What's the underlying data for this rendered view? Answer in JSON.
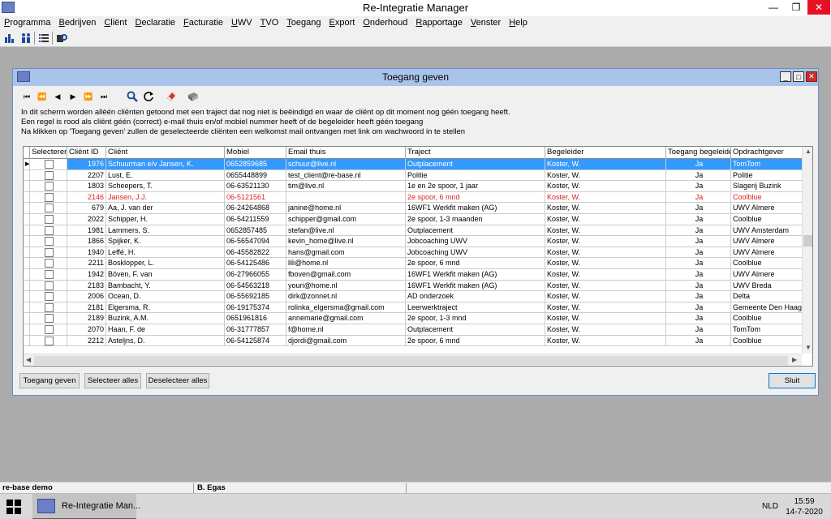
{
  "app": {
    "title": "Re-Integratie Manager",
    "min_icon": "—",
    "restore_icon": "❐",
    "close_icon": "✕"
  },
  "menu": [
    "Programma",
    "Bedrijven",
    "Cliënt",
    "Declaratie",
    "Facturatie",
    "UWV",
    "TVO",
    "Toegang",
    "Export",
    "Onderhoud",
    "Rapportage",
    "Venster",
    "Help"
  ],
  "toolbar_icons": [
    "bar-chart-icon",
    "people-icon",
    "list-icon",
    "key-icon"
  ],
  "dialog": {
    "title": "Toegang geven",
    "nav": [
      "⏮",
      "⏪",
      "◀",
      "▶",
      "⏩",
      "⏭"
    ],
    "info_lines": [
      "In dit scherm worden alléén cliënten getoond met een traject dat nog niet is beëindigd en waar de cliënt op dit moment nog géén toegang heeft.",
      "Een regel is rood als cliënt géén (correct) e-mail thuis en/of mobiel nummer heeft of de begeleider heeft géén toegang",
      "Na klikken op 'Toegang geven' zullen de geselecteerde cliënten een welkomst mail ontvangen met link om wachwoord in te stellen"
    ],
    "columns": [
      "Selecteren",
      "Cliënt ID",
      "Cliënt",
      "Mobiel",
      "Email thuis",
      "Traject",
      "Begeleider",
      "Toegang begeleider",
      "Opdrachtgever"
    ],
    "rows": [
      {
        "id": "1976",
        "client": "Schuurman e/v Jansen, K.",
        "mobiel": "0652859685",
        "email": "schuur@live.nl",
        "traject": "Outplacement",
        "begeleider": "Koster, W.",
        "toegang": "Ja",
        "opdrachtgever": "TomTom",
        "selected": true,
        "red": false
      },
      {
        "id": "2207",
        "client": "Lust, E.",
        "mobiel": "0655448899",
        "email": "test_client@re-base.nl",
        "traject": "Politie",
        "begeleider": "Koster, W.",
        "toegang": "Ja",
        "opdrachtgever": "Politie",
        "selected": false,
        "red": false
      },
      {
        "id": "1803",
        "client": "Scheepers, T.",
        "mobiel": "06-63521130",
        "email": "tim@live.nl",
        "traject": "1e en 2e spoor, 1 jaar",
        "begeleider": "Koster, W.",
        "toegang": "Ja",
        "opdrachtgever": "Slagerij Buzink",
        "selected": false,
        "red": false
      },
      {
        "id": "2146",
        "client": "Jansen, J.J.",
        "mobiel": "06-5121561",
        "email": "",
        "traject": "2e spoor, 6 mnd",
        "begeleider": "Koster, W.",
        "toegang": "Ja",
        "opdrachtgever": "Coolblue",
        "selected": false,
        "red": true
      },
      {
        "id": "679",
        "client": "Aa, J. van der",
        "mobiel": "06-24264868",
        "email": "janine@home.nl",
        "traject": "16WF1 Werkfit maken (AG)",
        "begeleider": "Koster, W.",
        "toegang": "Ja",
        "opdrachtgever": "UWV Almere",
        "selected": false,
        "red": false
      },
      {
        "id": "2022",
        "client": "Schipper, H.",
        "mobiel": "06-54211559",
        "email": "schipper@gmail.com",
        "traject": "2e spoor, 1-3 maanden",
        "begeleider": "Koster, W.",
        "toegang": "Ja",
        "opdrachtgever": "Coolblue",
        "selected": false,
        "red": false
      },
      {
        "id": "1981",
        "client": "Lammers, S.",
        "mobiel": "0652857485",
        "email": "stefan@live.nl",
        "traject": "Outplacement",
        "begeleider": "Koster, W.",
        "toegang": "Ja",
        "opdrachtgever": "UWV Amsterdam",
        "selected": false,
        "red": false
      },
      {
        "id": "1866",
        "client": "Spijker, K.",
        "mobiel": "06-56547094",
        "email": "kevin_home@live.nl",
        "traject": "Jobcoaching UWV",
        "begeleider": "Koster, W.",
        "toegang": "Ja",
        "opdrachtgever": "UWV Almere",
        "selected": false,
        "red": false
      },
      {
        "id": "1940",
        "client": "Leffé, H.",
        "mobiel": "06-45582822",
        "email": "hans@gmail.com",
        "traject": "Jobcoaching UWV",
        "begeleider": "Koster, W.",
        "toegang": "Ja",
        "opdrachtgever": "UWV Almere",
        "selected": false,
        "red": false
      },
      {
        "id": "2211",
        "client": "Bosklopper, L.",
        "mobiel": "06-54125486",
        "email": "lili@home.nl",
        "traject": "2e spoor, 6 mnd",
        "begeleider": "Koster, W.",
        "toegang": "Ja",
        "opdrachtgever": "Coolblue",
        "selected": false,
        "red": false
      },
      {
        "id": "1942",
        "client": "Böven, F. van",
        "mobiel": "06-27966055",
        "email": "fboven@gmail.com",
        "traject": "16WF1 Werkfit maken (AG)",
        "begeleider": "Koster, W.",
        "toegang": "Ja",
        "opdrachtgever": "UWV Almere",
        "selected": false,
        "red": false
      },
      {
        "id": "2183",
        "client": "Bambacht, Y.",
        "mobiel": "06-54563218",
        "email": "youri@home.nl",
        "traject": "16WF1 Werkfit maken (AG)",
        "begeleider": "Koster, W.",
        "toegang": "Ja",
        "opdrachtgever": "UWV Breda",
        "selected": false,
        "red": false
      },
      {
        "id": "2006",
        "client": "Ocean, D.",
        "mobiel": "06-55692185",
        "email": "dirk@zonnet.nl",
        "traject": "AD onderzoek",
        "begeleider": "Koster, W.",
        "toegang": "Ja",
        "opdrachtgever": "Delta",
        "selected": false,
        "red": false
      },
      {
        "id": "2181",
        "client": "Elgersma, R.",
        "mobiel": "06-19175374",
        "email": "rolinka_elgersma@gmail.com",
        "traject": "Leerwerktraject",
        "begeleider": "Koster, W.",
        "toegang": "Ja",
        "opdrachtgever": "Gemeente Den Haag",
        "selected": false,
        "red": false
      },
      {
        "id": "2189",
        "client": "Buzink, A.M.",
        "mobiel": "0651961816",
        "email": "annemarie@gmail.com",
        "traject": "2e spoor, 1-3 mnd",
        "begeleider": "Koster, W.",
        "toegang": "Ja",
        "opdrachtgever": "Coolblue",
        "selected": false,
        "red": false
      },
      {
        "id": "2070",
        "client": "Haan, F. de",
        "mobiel": "06-31777857",
        "email": "f@home.nl",
        "traject": "Outplacement",
        "begeleider": "Koster, W.",
        "toegang": "Ja",
        "opdrachtgever": "TomTom",
        "selected": false,
        "red": false
      },
      {
        "id": "2212",
        "client": "Asteljns, D.",
        "mobiel": "06-54125874",
        "email": "djordi@gmail.com",
        "traject": "2e spoor, 6 mnd",
        "begeleider": "Koster, W.",
        "toegang": "Ja",
        "opdrachtgever": "Coolblue",
        "selected": false,
        "red": false
      }
    ],
    "buttons": {
      "toegang": "Toegang geven",
      "select_all": "Selecteer alles",
      "deselect_all": "Deselecteer alles",
      "close": "Sluit"
    }
  },
  "status": {
    "database": "re-base demo",
    "user": "B. Egas"
  },
  "taskbar": {
    "app_label": "Re-Integratie Man...",
    "lang": "NLD",
    "time": "15:59",
    "date": "14-7-2020"
  }
}
